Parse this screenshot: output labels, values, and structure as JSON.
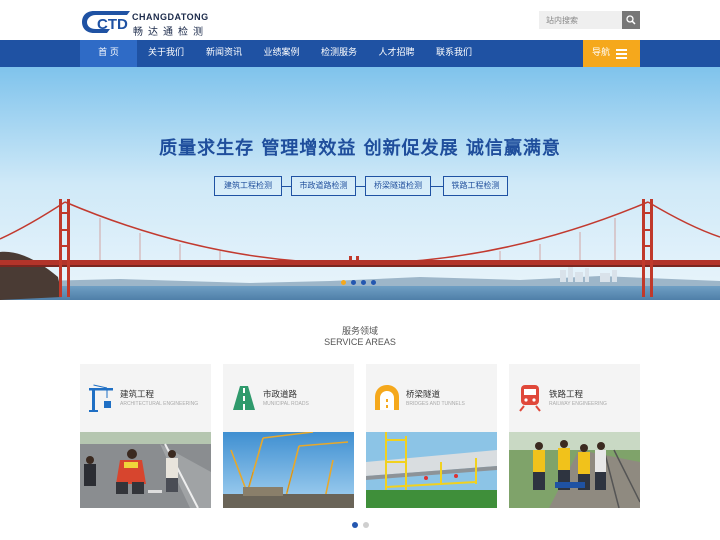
{
  "header": {
    "logo_en": "CHANGDATONG",
    "logo_cn": "畅达通检测",
    "logo_mark": "CTD",
    "search_placeholder": "站内搜索"
  },
  "nav": {
    "items": [
      {
        "label": "首  页",
        "active": true
      },
      {
        "label": "关于我们"
      },
      {
        "label": "新闻资讯"
      },
      {
        "label": "业绩案例"
      },
      {
        "label": "检测服务"
      },
      {
        "label": "人才招聘"
      },
      {
        "label": "联系我们"
      }
    ],
    "guide_label": "导航"
  },
  "banner": {
    "slogan": "质量求生存  管理增效益  创新促发展  诚信赢满意",
    "tags": [
      "建筑工程检测",
      "市政道路检测",
      "桥梁隧道检测",
      "铁路工程检测"
    ],
    "slide_count": 4,
    "active_slide": 1
  },
  "services": {
    "title": "服务领域",
    "subtitle": "SERVICE AREAS",
    "cards": [
      {
        "title": "建筑工程",
        "en": "ARCHITECTURAL ENGINEERING",
        "icon": "crane-icon"
      },
      {
        "title": "市政道路",
        "en": "MUNICIPAL ROADS",
        "icon": "road-icon"
      },
      {
        "title": "桥梁隧道",
        "en": "BRIDGES AND TUNNELS",
        "icon": "tunnel-icon"
      },
      {
        "title": "铁路工程",
        "en": "RAILWAY ENGINEERING",
        "icon": "train-icon"
      }
    ],
    "pages": 2,
    "active_page": 1
  },
  "colors": {
    "nav_blue": "#1f52a3",
    "accent_orange": "#f5a81c",
    "icon_blue": "#1f6fc4",
    "icon_green": "#2f9a6c",
    "icon_orange": "#f5a81c",
    "icon_red": "#e0483a"
  }
}
